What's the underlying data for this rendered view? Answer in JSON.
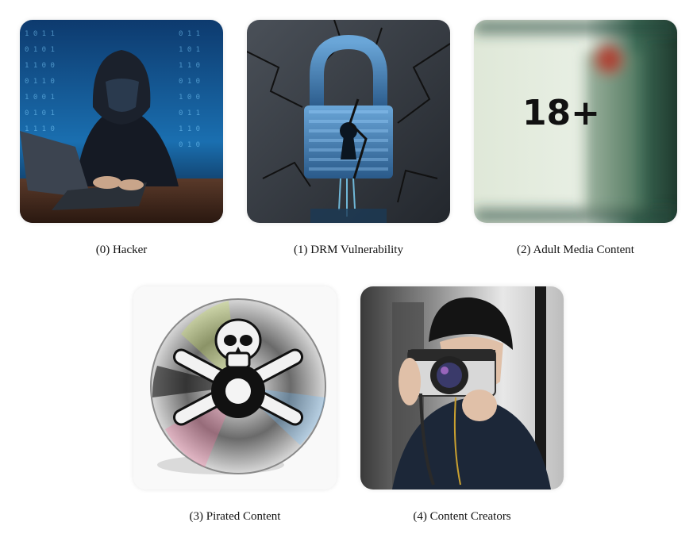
{
  "items": [
    {
      "caption": "(0) Hacker",
      "icon": "hacker-image"
    },
    {
      "caption": "(1) DRM Vulnerability",
      "icon": "broken-padlock-image"
    },
    {
      "caption": "(2) Adult Media Content",
      "icon": "adult-content-image",
      "overlay_text": "18+"
    },
    {
      "caption": "(3) Pirated Content",
      "icon": "pirate-disc-image"
    },
    {
      "caption": "(4) Content Creators",
      "icon": "photographer-image"
    }
  ]
}
